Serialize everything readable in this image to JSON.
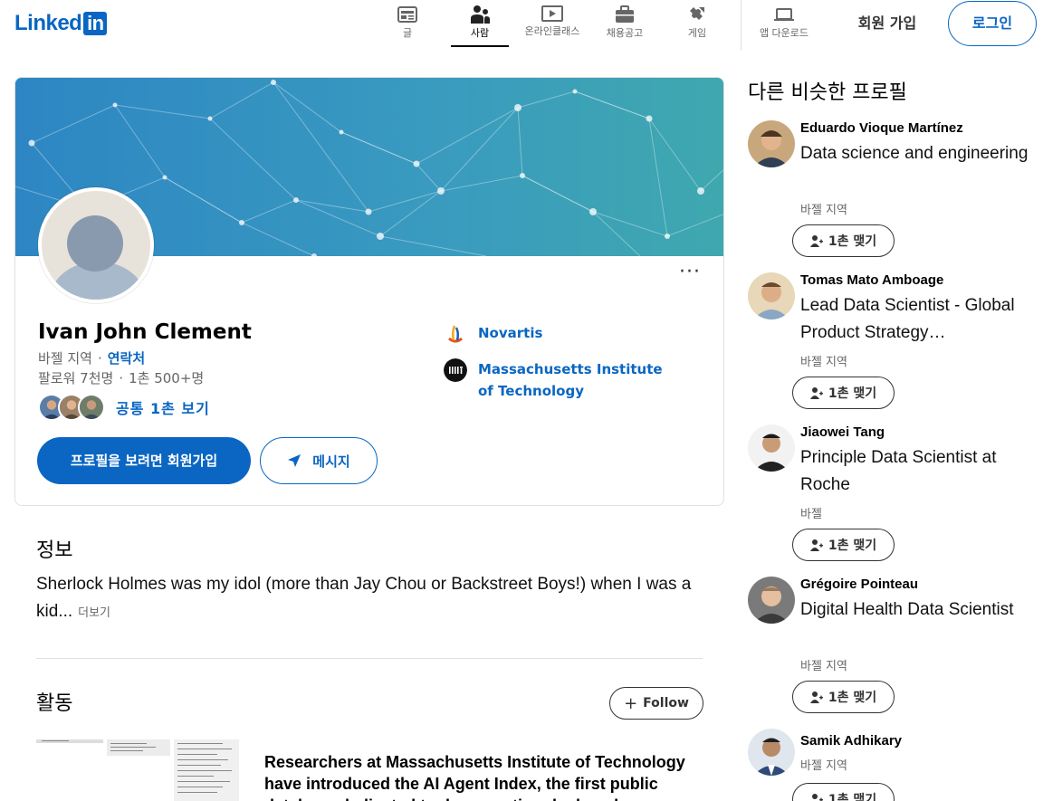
{
  "header": {
    "logo_text": "Linked",
    "logo_in": "in",
    "nav": [
      {
        "label": "글",
        "icon": "article-icon"
      },
      {
        "label": "사람",
        "icon": "people-icon",
        "active": true
      },
      {
        "label": "온라인클래스",
        "icon": "learning-icon"
      },
      {
        "label": "채용공고",
        "icon": "briefcase-icon"
      },
      {
        "label": "게임",
        "icon": "puzzle-icon"
      },
      {
        "label": "앱 다운로드",
        "icon": "laptop-icon"
      }
    ],
    "join_label": "회원 가입",
    "login_label": "로그인"
  },
  "profile": {
    "name": "Ivan John Clement",
    "location": "바젤 지역",
    "contact_label": "연락처",
    "followers": "팔로워 7천명",
    "connections": "1촌 500+명",
    "mutual_label": "공통 1촌 보기",
    "signup_button": "프로필을 보려면 회원가입",
    "message_button": "메시지",
    "more_label": "···",
    "orgs": [
      {
        "name": "Novartis"
      },
      {
        "name": "Massachusetts Institute of Technology"
      }
    ]
  },
  "about": {
    "title": "정보",
    "text": "Sherlock Holmes was my idol (more than Jay Chou or Backstreet Boys!) when I was a kid...",
    "more_label": "더보기"
  },
  "activity": {
    "title": "활동",
    "follow_label": "Follow",
    "post_title": "Researchers at Massachusetts Institute of Technology have introduced the AI Agent Index, the first public database dedicated to documenting deployed"
  },
  "sidebar": {
    "title": "다른 비슷한 프로필",
    "connect_label": "1촌 맺기",
    "people": [
      {
        "name": "Eduardo Vioque Martínez",
        "title": "Data science and engineering",
        "location": "바젤 지역"
      },
      {
        "name": "Tomas Mato Amboage",
        "title": "Lead Data Scientist - Global Product Strategy…",
        "location": "바젤 지역"
      },
      {
        "name": "Jiaowei Tang",
        "title": "Principle Data Scientist at Roche",
        "location": "바젤"
      },
      {
        "name": "Grégoire Pointeau",
        "title": "Digital Health Data Scientist",
        "location": "바젤 지역"
      },
      {
        "name": "Samik Adhikary",
        "title": "",
        "location": "바젤 지역"
      }
    ]
  },
  "colors": {
    "accent": "#0a66c2",
    "banner": "#3a9bbf"
  }
}
